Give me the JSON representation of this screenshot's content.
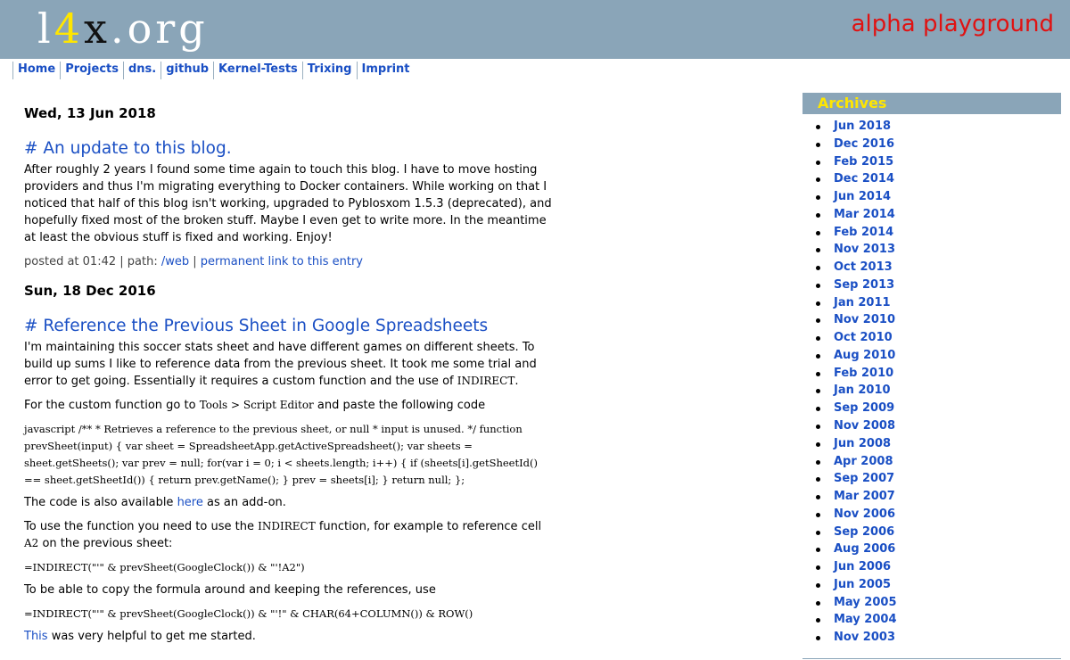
{
  "header": {
    "logo_l1": "l",
    "logo_4": "4",
    "logo_x": "x",
    "logo_org": ".org",
    "tagline": "alpha playground"
  },
  "nav": [
    "Home",
    "Projects",
    "dns.",
    "github",
    "Kernel-Tests",
    "Trixing",
    "Imprint"
  ],
  "posts": [
    {
      "date": "Wed, 13 Jun 2018",
      "title": "# An update to this blog.",
      "body": "After roughly 2 years I found some time again to touch this blog. I have to move hosting providers and thus I'm migrating everything to Docker containers. While working on that I noticed that half of this blog isn't working, upgraded to Pyblosxom 1.5.3 (deprecated), and hopefully fixed most of the broken stuff. Maybe I even get to write more. In the meantime at least the obvious stuff is fixed and working. Enjoy!",
      "meta_posted": "posted at 01:42 | path: ",
      "meta_path": "/web",
      "meta_sep": " | ",
      "meta_link": "permanent link to this entry"
    },
    {
      "date": "Sun, 18 Dec 2016",
      "title": "# Reference the Previous Sheet in Google Spreadsheets",
      "p1_text": "I'm maintaining this soccer stats sheet and have different games on different sheets. To build up sums I like to reference data from the previous sheet. It took me some trial and error to get going. Essentially it requires a custom function and the use of ",
      "p1_code": "INDIRECT",
      "p1_end": ".",
      "p2_text": "For the custom function go to ",
      "p2_code": "Tools > Script Editor",
      "p2_end": " and paste the following code",
      "code_block": "javascript /** * Retrieves a reference to the previous sheet, or null * input is unused. */ function prevSheet(input) { var sheet = SpreadsheetApp.getActiveSpreadsheet(); var sheets = sheet.getSheets(); var prev = null; for(var i = 0; i < sheets.length; i++) { if (sheets[i].getSheetId() == sheet.getSheetId()) { return prev.getName(); } prev = sheets[i]; } return null; };",
      "p3_text": "The code is also available ",
      "p3_link": "here",
      "p3_end": " as an add-on.",
      "p4_text": "To use the function you need to use the ",
      "p4_code": "INDIRECT",
      "p4_mid": " function, for example to reference cell ",
      "p4_code2": "A2",
      "p4_end": " on the previous sheet:",
      "formula1": "=INDIRECT(\"'\" & prevSheet(GoogleClock()) & \"'!A2\")",
      "p5_text": "To be able to copy the formula around and keeping the references, use",
      "formula2": "=INDIRECT(\"'\" & prevSheet(GoogleClock()) & \"'!\" & CHAR(64+COLUMN()) & ROW()",
      "p6_link": "This",
      "p6_end": " was very helpful to get me started."
    }
  ],
  "sidebar": {
    "heading": "Archives",
    "items": [
      "Jun 2018",
      "Dec 2016",
      "Feb 2015",
      "Dec 2014",
      "Jun 2014",
      "Mar 2014",
      "Feb 2014",
      "Nov 2013",
      "Oct 2013",
      "Sep 2013",
      "Jan 2011",
      "Nov 2010",
      "Oct 2010",
      "Aug 2010",
      "Feb 2010",
      "Jan 2010",
      "Sep 2009",
      "Nov 2008",
      "Jun 2008",
      "Apr 2008",
      "Sep 2007",
      "Mar 2007",
      "Nov 2006",
      "Sep 2006",
      "Aug 2006",
      "Jun 2006",
      "Jun 2005",
      "May 2005",
      "May 2004",
      "Nov 2003"
    ]
  },
  "colors": {
    "header_bg": "#8aa5b8",
    "link": "#1a4fc4",
    "tagline": "#e01212",
    "logo_accent": "#ffe600"
  }
}
